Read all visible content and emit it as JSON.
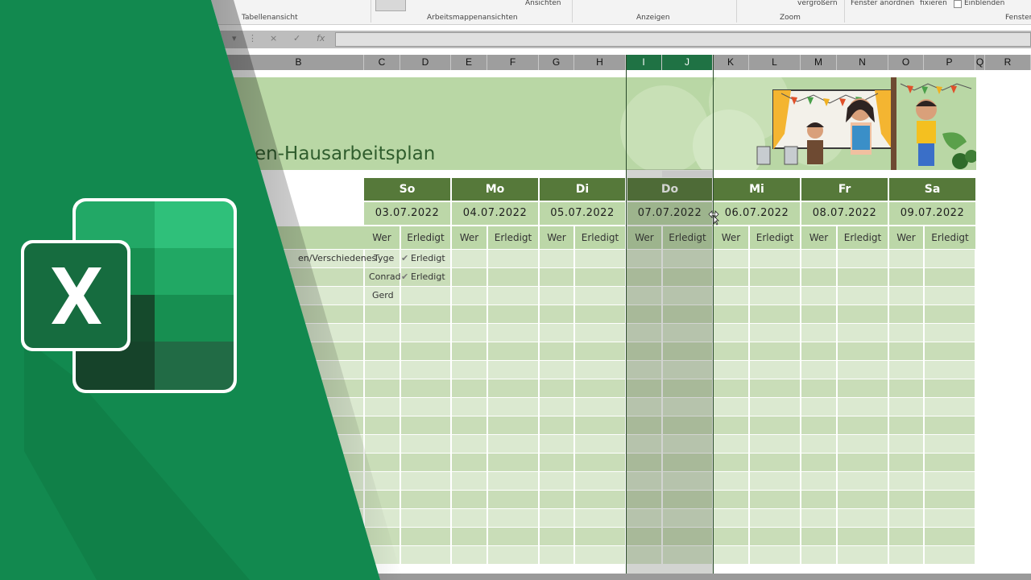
{
  "ribbon": {
    "groups": [
      "Tabellenansicht",
      "Arbeitsmappenansichten",
      "Anzeigen",
      "Zoom",
      "Fenster"
    ],
    "top_items": {
      "ansichten": "Ansichten",
      "vergroessern": "vergrößern",
      "fenster_anordnen": "Fenster anordnen",
      "fixieren": "fixieren",
      "einblenden": "Einblenden"
    }
  },
  "formula_bar": {
    "cancel_icon": "×",
    "enter_icon": "✓",
    "fx_label": "fx",
    "name_box_dropdown": "▾",
    "dots": "⋮"
  },
  "columns": [
    "B",
    "C",
    "D",
    "E",
    "F",
    "G",
    "H",
    "I",
    "J",
    "K",
    "L",
    "M",
    "N",
    "O",
    "P",
    "Q",
    "R"
  ],
  "selected_columns": [
    "I",
    "J"
  ],
  "sheet": {
    "title": "en-Hausarbeitsplan",
    "row_label_partial": "en/Verschiedenes",
    "days": [
      {
        "day": "So",
        "date": "03.07.2022"
      },
      {
        "day": "Mo",
        "date": "04.07.2022"
      },
      {
        "day": "Di",
        "date": "05.07.2022"
      },
      {
        "day": "Do",
        "date": "07.07.2022"
      },
      {
        "day": "Mi",
        "date": "06.07.2022"
      },
      {
        "day": "Fr",
        "date": "08.07.2022"
      },
      {
        "day": "Sa",
        "date": "09.07.2022"
      }
    ],
    "sub_headers": {
      "who": "Wer",
      "done": "Erledigt"
    },
    "entries": [
      {
        "who": "Tyge",
        "done": "Erledigt"
      },
      {
        "who": "Conrad",
        "done": "Erledigt"
      },
      {
        "who": "Gerd",
        "done": ""
      }
    ]
  },
  "colors": {
    "excel_green": "#1f7244",
    "header_green": "#56793a",
    "light_green": "#bcd7a8",
    "row_green_a": "#dbe9d0",
    "row_green_b": "#c9ddb8"
  },
  "icons": [
    "excel-logo-icon",
    "check-icon",
    "cursor-resize-icon"
  ]
}
